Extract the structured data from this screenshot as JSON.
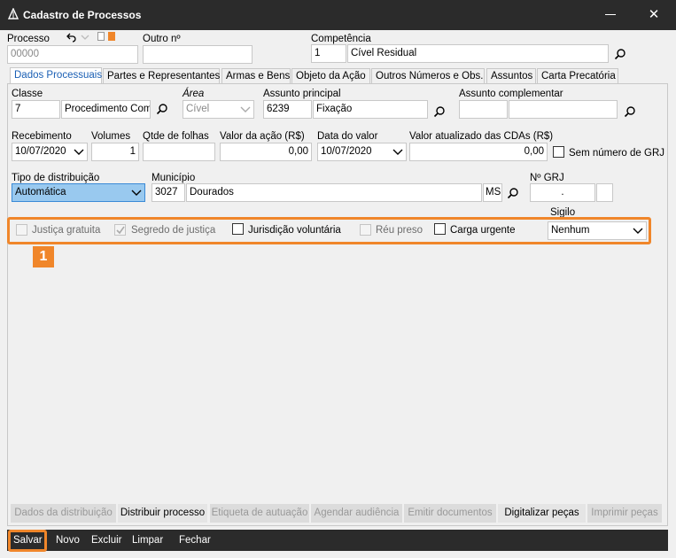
{
  "window": {
    "title": "Cadastro de Processos"
  },
  "processo": {
    "label": "Processo",
    "value": "00000",
    "outro_label": "Outro nº",
    "outro_value": ""
  },
  "competencia": {
    "label": "Competência",
    "code": "1",
    "name": "Cível Residual"
  },
  "tabs": [
    "Dados Processuais",
    "Partes e Representantes",
    "Armas e Bens",
    "Objeto da Ação",
    "Outros Números e Obs.",
    "Assuntos",
    "Carta Precatória"
  ],
  "classe": {
    "label": "Classe",
    "code": "7",
    "name": "Procedimento Com"
  },
  "area": {
    "label": "Área",
    "value": "Cível"
  },
  "assunto_principal": {
    "label": "Assunto principal",
    "code": "6239",
    "name": "Fixação"
  },
  "assunto_complementar": {
    "label": "Assunto complementar",
    "code": "",
    "name": ""
  },
  "recebimento": {
    "label": "Recebimento",
    "value": "10/07/2020"
  },
  "volumes": {
    "label": "Volumes",
    "value": "1"
  },
  "qtde_folhas": {
    "label": "Qtde de folhas",
    "value": ""
  },
  "valor_acao": {
    "label": "Valor da ação (R$)",
    "value": "0,00"
  },
  "data_valor": {
    "label": "Data do valor",
    "value": "10/07/2020"
  },
  "valor_cdas": {
    "label": "Valor atualizado das CDAs (R$)",
    "value": "0,00"
  },
  "sem_grj": {
    "label": "Sem número de GRJ"
  },
  "tipo_distribuicao": {
    "label": "Tipo de distribuição",
    "value": "Automática"
  },
  "municipio": {
    "label": "Município",
    "code": "3027",
    "name": "Dourados",
    "uf": "MS"
  },
  "grj": {
    "label": "Nº GRJ",
    "value": "."
  },
  "sigilo": {
    "label": "Sigilo",
    "value": "Nenhum"
  },
  "flags": {
    "justica_gratuita": "Justiça gratuita",
    "segredo_justica": "Segredo de justiça",
    "jurisdicao_voluntaria": "Jurisdição voluntária",
    "reu_preso": "Réu preso",
    "carga_urgente": "Carga urgente"
  },
  "badge": "1",
  "actions": {
    "dados_distribuicao": "Dados da distribuição",
    "distribuir": "Distribuir processo",
    "etiqueta": "Etiqueta de autuação",
    "agendar": "Agendar audiência",
    "emitir": "Emitir documentos",
    "digitalizar": "Digitalizar peças",
    "imprimir": "Imprimir peças"
  },
  "bottom": {
    "salvar": "Salvar",
    "novo": "Novo",
    "excluir": "Excluir",
    "limpar": "Limpar",
    "fechar": "Fechar"
  },
  "colors": {
    "accent": "#f0862a",
    "titlebar": "#2b2b2b",
    "selection": "#99c9ef"
  }
}
